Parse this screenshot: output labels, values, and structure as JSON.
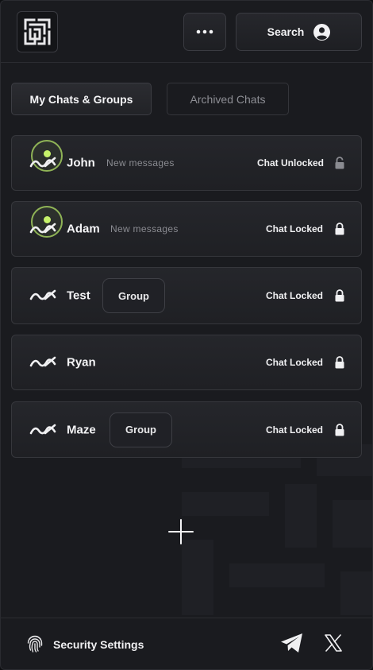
{
  "header": {
    "logo_icon": "maze-logo-icon",
    "more_icon": "more-horizontal-icon",
    "search_label": "Search",
    "search_icon": "user-circle-icon"
  },
  "tabs": [
    {
      "label": "My Chats & Groups",
      "active": true
    },
    {
      "label": "Archived Chats",
      "active": false
    }
  ],
  "chats": [
    {
      "name": "John",
      "subtitle": "New messages",
      "group_label": "",
      "status": "Chat Unlocked",
      "locked": false,
      "unread": true
    },
    {
      "name": "Adam",
      "subtitle": "New messages",
      "group_label": "",
      "status": "Chat Locked",
      "locked": true,
      "unread": true
    },
    {
      "name": "Test",
      "subtitle": "",
      "group_label": "Group",
      "status": "Chat Locked",
      "locked": true,
      "unread": false
    },
    {
      "name": "Ryan",
      "subtitle": "",
      "group_label": "",
      "status": "Chat Locked",
      "locked": true,
      "unread": false
    },
    {
      "name": "Maze",
      "subtitle": "",
      "group_label": "Group",
      "status": "Chat Locked",
      "locked": true,
      "unread": false
    }
  ],
  "add_icon": "plus-icon",
  "footer": {
    "settings_label": "Security Settings",
    "settings_icon": "fingerprint-icon",
    "telegram_icon": "telegram-icon",
    "x_icon": "x-twitter-icon"
  },
  "colors": {
    "background": "#1a1b1f",
    "accent_green": "#c6f26a",
    "ring_green": "#8fb356",
    "muted_text": "#8a8b91"
  }
}
